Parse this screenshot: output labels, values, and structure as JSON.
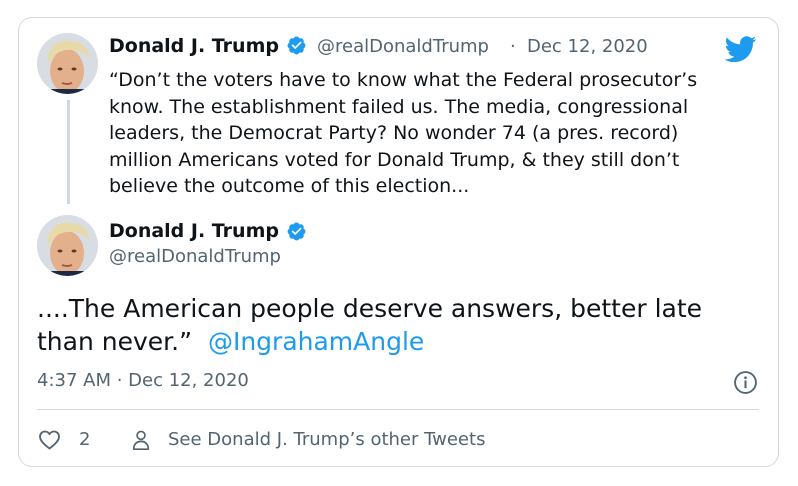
{
  "quoted_tweet": {
    "author_name": "Donald J. Trump",
    "verified": true,
    "handle": "@realDonaldTrump",
    "separator": "·",
    "date": "Dec 12, 2020",
    "text_lines": [
      "“Don’t the voters have to know what the Federal prosecutor’s",
      "know. The establishment failed us. The media, congressional",
      "leaders, the Democrat Party? No wonder 74 (a pres. record)",
      "million Americans voted for Donald Trump, & they still don’t",
      "believe the outcome of this election..."
    ]
  },
  "main_tweet": {
    "author_name": "Donald J. Trump",
    "verified": true,
    "handle": "@realDonaldTrump",
    "text_line1": "....The American people deserve answers, better late",
    "text_line2": "than never.”",
    "mention": "@IngrahamAngle",
    "timestamp": "4:37 AM · Dec 12, 2020"
  },
  "actions": {
    "like_count": "2",
    "see_other_tweets": "See Donald J. Trump’s other Tweets"
  },
  "icons": {
    "brand": "twitter-bird-icon",
    "verified": "verified-badge-icon",
    "info": "info-icon",
    "like": "heart-icon",
    "profile": "person-icon"
  },
  "colors": {
    "twitter_blue": "#1d9bf0",
    "text_primary": "#0f1419",
    "text_secondary": "#536471",
    "border": "#cfd9de"
  }
}
